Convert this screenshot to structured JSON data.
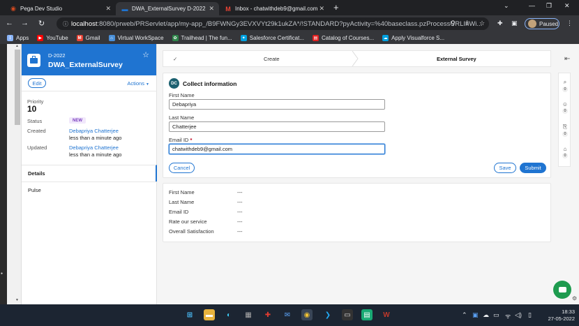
{
  "browser": {
    "tabs": [
      {
        "label": "Pega Dev Studio",
        "active": false
      },
      {
        "label": "DWA_ExternalSurvey D-2022",
        "active": true
      },
      {
        "label": "Inbox - chatwithdeb9@gmail.com",
        "active": false
      }
    ],
    "url_host": "localhost",
    "url_rest": ":8080/prweb/PRServlet/app/my-app_/B9FWNGy3EVXVYt29k1ukZA*/!STANDARD?pyActivity=%40baseclass.pzProcessURLInWi...",
    "profile_label": "Paused",
    "bookmarks": [
      {
        "label": "Apps",
        "icon": "apps-grid-icon",
        "color": "#8ab4f8"
      },
      {
        "label": "YouTube",
        "icon": "youtube-icon",
        "color": "#ff0000"
      },
      {
        "label": "Gmail",
        "icon": "gmail-icon",
        "color": "#ea4335"
      },
      {
        "label": "Virtual WorkSpace",
        "icon": "workspace-icon",
        "color": "#4a90d9"
      },
      {
        "label": "Trailhead | The fun...",
        "icon": "trailhead-icon",
        "color": "#2e844a"
      },
      {
        "label": "Salesforce Certificat...",
        "icon": "salesforce-icon",
        "color": "#00a1e0"
      },
      {
        "label": "Catalog of Courses...",
        "icon": "catalog-icon",
        "color": "#e02020"
      },
      {
        "label": "Apply Visualforce S...",
        "icon": "visualforce-icon",
        "color": "#00a1e0"
      }
    ]
  },
  "case": {
    "id": "D-2022",
    "title": "DWA_ExternalSurvey",
    "edit_label": "Edit",
    "actions_label": "Actions",
    "priority_label": "Priority",
    "priority_value": "10",
    "status_label": "Status",
    "status_value": "NEW",
    "created_label": "Created",
    "created_by": "Debapriya Chatterjee",
    "created_when": "less than a minute ago",
    "updated_label": "Updated",
    "updated_by": "Debapriya Chatterjee",
    "updated_when": "less than a minute ago",
    "nav": [
      {
        "label": "Details",
        "active": true
      },
      {
        "label": "Pulse",
        "active": false
      }
    ],
    "accent_color": "#1f74d1"
  },
  "stages": [
    {
      "label": "Create",
      "state": "completed"
    },
    {
      "label": "External Survey",
      "state": "current"
    }
  ],
  "form": {
    "avatar_initials": "DC",
    "title": "Collect information",
    "fields": [
      {
        "label": "First Name",
        "value": "Debapriya",
        "required": false
      },
      {
        "label": "Last Name",
        "value": "Chatterjee",
        "required": false
      },
      {
        "label": "Email ID",
        "value": "chatwithdeb9@gmail.com",
        "required": true
      }
    ],
    "required_marker": "*",
    "cancel_label": "Cancel",
    "save_label": "Save",
    "submit_label": "Submit"
  },
  "summary": {
    "rows": [
      {
        "label": "First Name",
        "value": "---"
      },
      {
        "label": "Last Name",
        "value": "---"
      },
      {
        "label": "Email ID",
        "value": "---"
      },
      {
        "label": "Rate our service",
        "value": "---"
      },
      {
        "label": "Overall Satisfaction",
        "value": "---"
      }
    ]
  },
  "utilities": [
    {
      "icon": "paperclip-icon",
      "count": "0"
    },
    {
      "icon": "followers-icon",
      "count": "0"
    },
    {
      "icon": "related-cases-icon",
      "count": "0"
    },
    {
      "icon": "tags-icon",
      "count": "0"
    }
  ],
  "taskbar": {
    "time": "18:33",
    "date": "27-05-2022"
  }
}
